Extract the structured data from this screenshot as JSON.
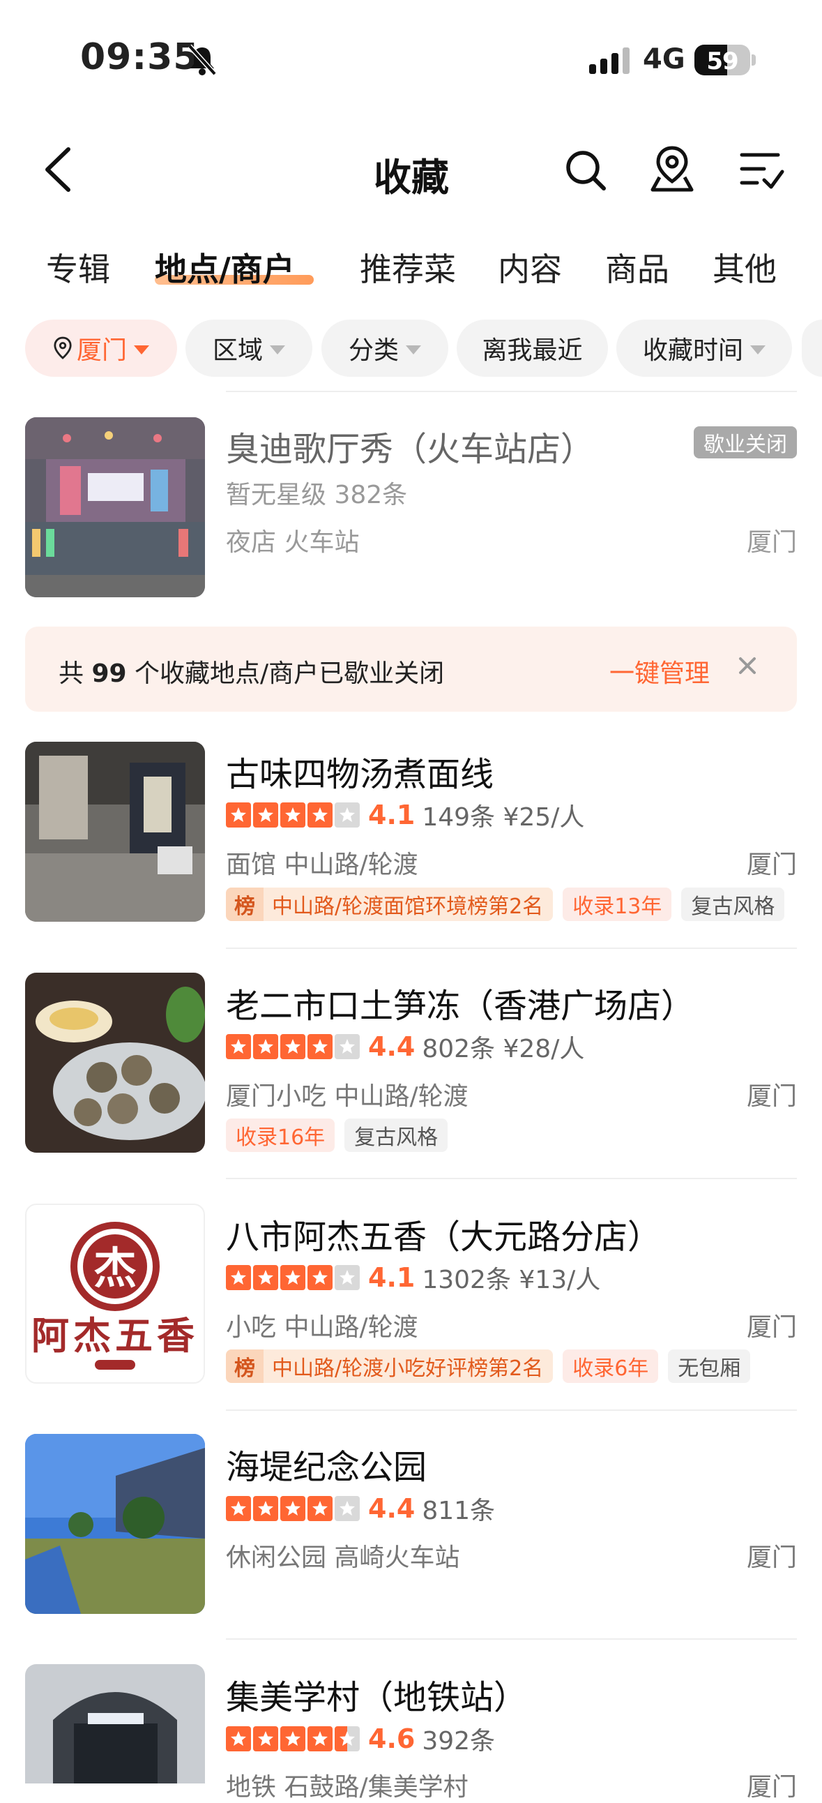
{
  "status_bar": {
    "time": "09:35",
    "network": "4G",
    "battery": "59"
  },
  "header": {
    "title": "收藏"
  },
  "tabs": [
    {
      "label": "专辑"
    },
    {
      "label": "地点/商户"
    },
    {
      "label": "推荐菜"
    },
    {
      "label": "内容"
    },
    {
      "label": "商品"
    },
    {
      "label": "其他"
    }
  ],
  "filters": {
    "city": "厦门",
    "area": "区域",
    "category": "分类",
    "nearest": "离我最近",
    "time": "收藏时间"
  },
  "closed_item": {
    "name": "臭迪歌厅秀（火车站店）",
    "badge": "歇业关闭",
    "meta": "暂无星级 382条",
    "sub": "夜店 火车站",
    "city": "厦门"
  },
  "banner": {
    "prefix": "共",
    "count": "99",
    "suffix": "个收藏地点/商户已歇业关闭",
    "action": "一键管理"
  },
  "items": [
    {
      "name": "古味四物汤煮面线",
      "stars": 4,
      "rating": "4.1",
      "reviews": "149条 ¥25/人",
      "sub": "面馆 中山路/轮渡",
      "city": "厦门",
      "rank_icon": "榜",
      "rank_tag": "中山路/轮渡面馆环境榜第2名",
      "year_tag": "收录13年",
      "plain_tag": "复古风格"
    },
    {
      "name": "老二市口土笋冻（香港广场店）",
      "stars": 4,
      "rating": "4.4",
      "reviews": "802条 ¥28/人",
      "sub": "厦门小吃 中山路/轮渡",
      "city": "厦门",
      "year_tag": "收录16年",
      "plain_tag": "复古风格"
    },
    {
      "name": "八市阿杰五香（大元路分店）",
      "stars": 4,
      "rating": "4.1",
      "reviews": "1302条 ¥13/人",
      "sub": "小吃 中山路/轮渡",
      "city": "厦门",
      "rank_icon": "榜",
      "rank_tag": "中山路/轮渡小吃好评榜第2名",
      "year_tag": "收录6年",
      "plain_tag": "无包厢",
      "logo_char": "杰",
      "logo_text": "阿杰五香"
    },
    {
      "name": "海堤纪念公园",
      "stars": 4,
      "rating": "4.4",
      "reviews": "811条",
      "sub": "休闲公园 高崎火车站",
      "city": "厦门"
    },
    {
      "name": "集美学村（地铁站）",
      "stars": 4.5,
      "rating": "4.6",
      "reviews": "392条",
      "sub": "地铁 石鼓路/集美学村",
      "city": "厦门"
    }
  ]
}
